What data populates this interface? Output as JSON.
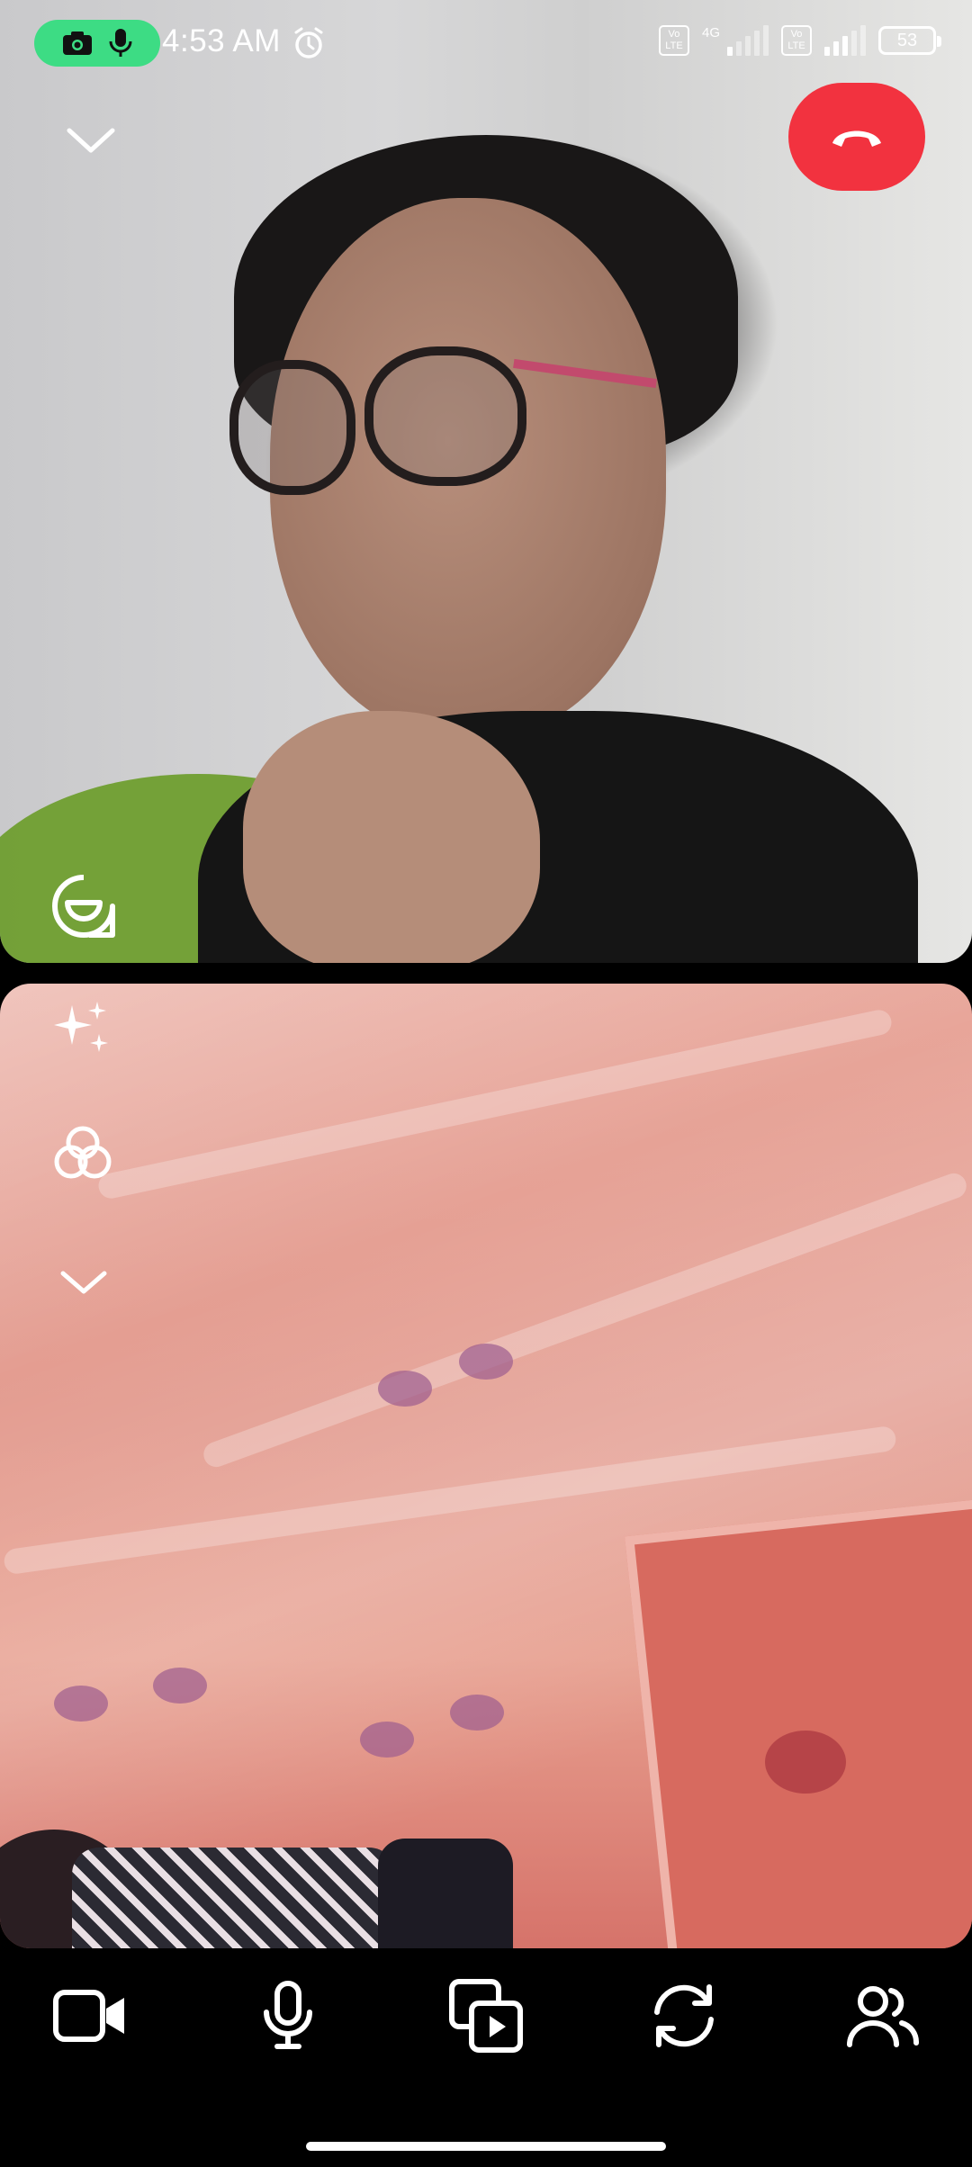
{
  "status_bar": {
    "time": "4:53 AM",
    "network_type": "4G",
    "volte_label_1": "Vo\nLTE",
    "volte_label_2": "Vo\nLTE",
    "battery_level": "53",
    "indicators": [
      "camera-in-use-icon",
      "mic-in-use-icon",
      "alarm-icon"
    ]
  },
  "call": {
    "end_call_color": "#f2323f",
    "controls": [
      {
        "name": "video-camera-button",
        "icon": "video-camera-icon"
      },
      {
        "name": "microphone-button",
        "icon": "microphone-icon"
      },
      {
        "name": "share-media-button",
        "icon": "media-share-icon"
      },
      {
        "name": "flip-camera-button",
        "icon": "flip-camera-icon"
      },
      {
        "name": "participants-button",
        "icon": "people-icon"
      }
    ]
  },
  "local_tile": {
    "tools": [
      "effects-sparkle-icon",
      "filters-icon",
      "chevron-down-icon"
    ]
  },
  "remote_tile": {
    "tools": [
      "collapse-chevron-icon",
      "lens-face-icon"
    ]
  }
}
